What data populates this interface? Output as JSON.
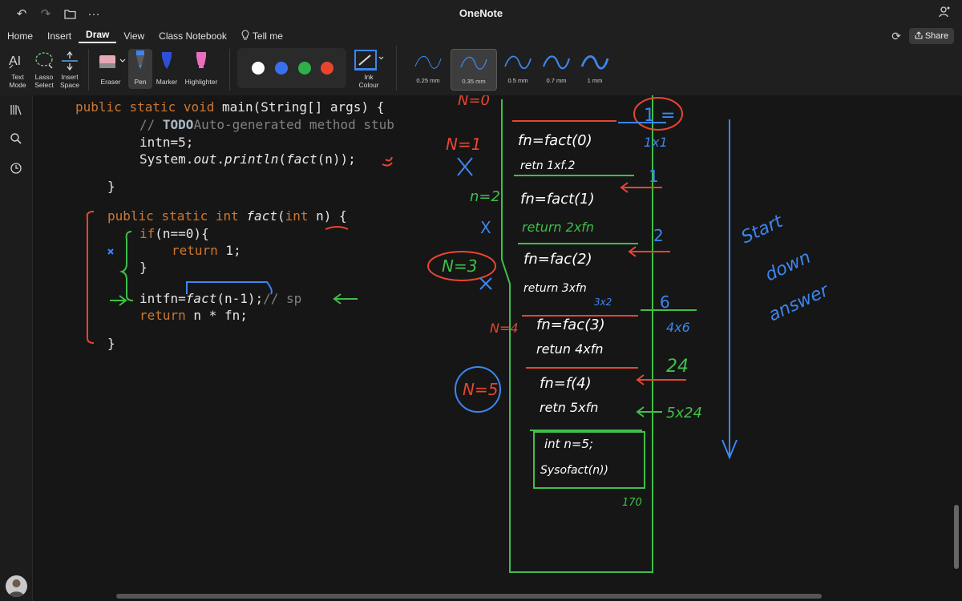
{
  "app": {
    "title": "OneNote",
    "undo_icon": "undo-icon",
    "redo_icon": "redo-icon",
    "folder_icon": "folder-icon",
    "more_icon": "more-icon",
    "account_icon": "account-icon"
  },
  "menu": {
    "items": [
      "Home",
      "Insert",
      "Draw",
      "View",
      "Class Notebook"
    ],
    "active": "Draw",
    "tell_me": "Tell me",
    "share": "Share"
  },
  "ribbon": {
    "text_mode": "Text\nMode",
    "lasso_select": "Lasso\nSelect",
    "insert_space": "Insert\nSpace",
    "eraser": "Eraser",
    "pen": "Pen",
    "marker": "Marker",
    "highlighter": "Highlighter",
    "ink_colour": "Ink\nColour",
    "pen_colors": [
      "#ffffff",
      "#3b6ff0",
      "#2fae4a",
      "#e8452f"
    ],
    "thickness": [
      "0.25 mm",
      "0.35 mm",
      "0.5 mm",
      "0.7 mm",
      "1 mm"
    ],
    "selected_thickness": "0.35 mm"
  },
  "code": {
    "main_sig": "public static void main(String[] args) {",
    "todo_comment_prefix": "// ",
    "todo_word": "TODO",
    "todo_comment_rest": "Auto-generated method stub",
    "intn_line": "intn=5;",
    "println_line": "System.out.println(fact(n));",
    "close_main": "}",
    "fact_sig": "public static int fact(int n) {",
    "if_line": "if(n==0){",
    "return1": "return 1;",
    "close_if": "}",
    "intfn_line": "intfn=fact(n-1);// sp",
    "return_n": "return n * fn;",
    "close_fact": "}"
  },
  "handwriting": {
    "stack_frames": [
      "N=0",
      "fn=fact(0)",
      "retn 1xf.2",
      "fn=fact(1)",
      "return 2xfn",
      "fn=fac(2)",
      "return 3xfn",
      "3x2",
      "fn=fac(3)",
      "retun 4xfn",
      "fn=f(4)",
      "retn 5xfn",
      "int n=5;",
      "Sysofact(n))"
    ],
    "left_labels": [
      "N=1",
      "n=2",
      "N=3",
      "N=4",
      "N=5"
    ],
    "right_values": [
      "1",
      "1x1",
      "1",
      "2",
      "6",
      "4x6",
      "24",
      "5x24",
      "170"
    ],
    "note": [
      "Start",
      "down",
      "answer"
    ]
  },
  "colors": {
    "keyword": "#cc7832",
    "comment": "#808080",
    "ink_red": "#e8452f",
    "ink_green": "#3fbf4a",
    "ink_blue": "#3b86f0",
    "bg": "#161616"
  }
}
